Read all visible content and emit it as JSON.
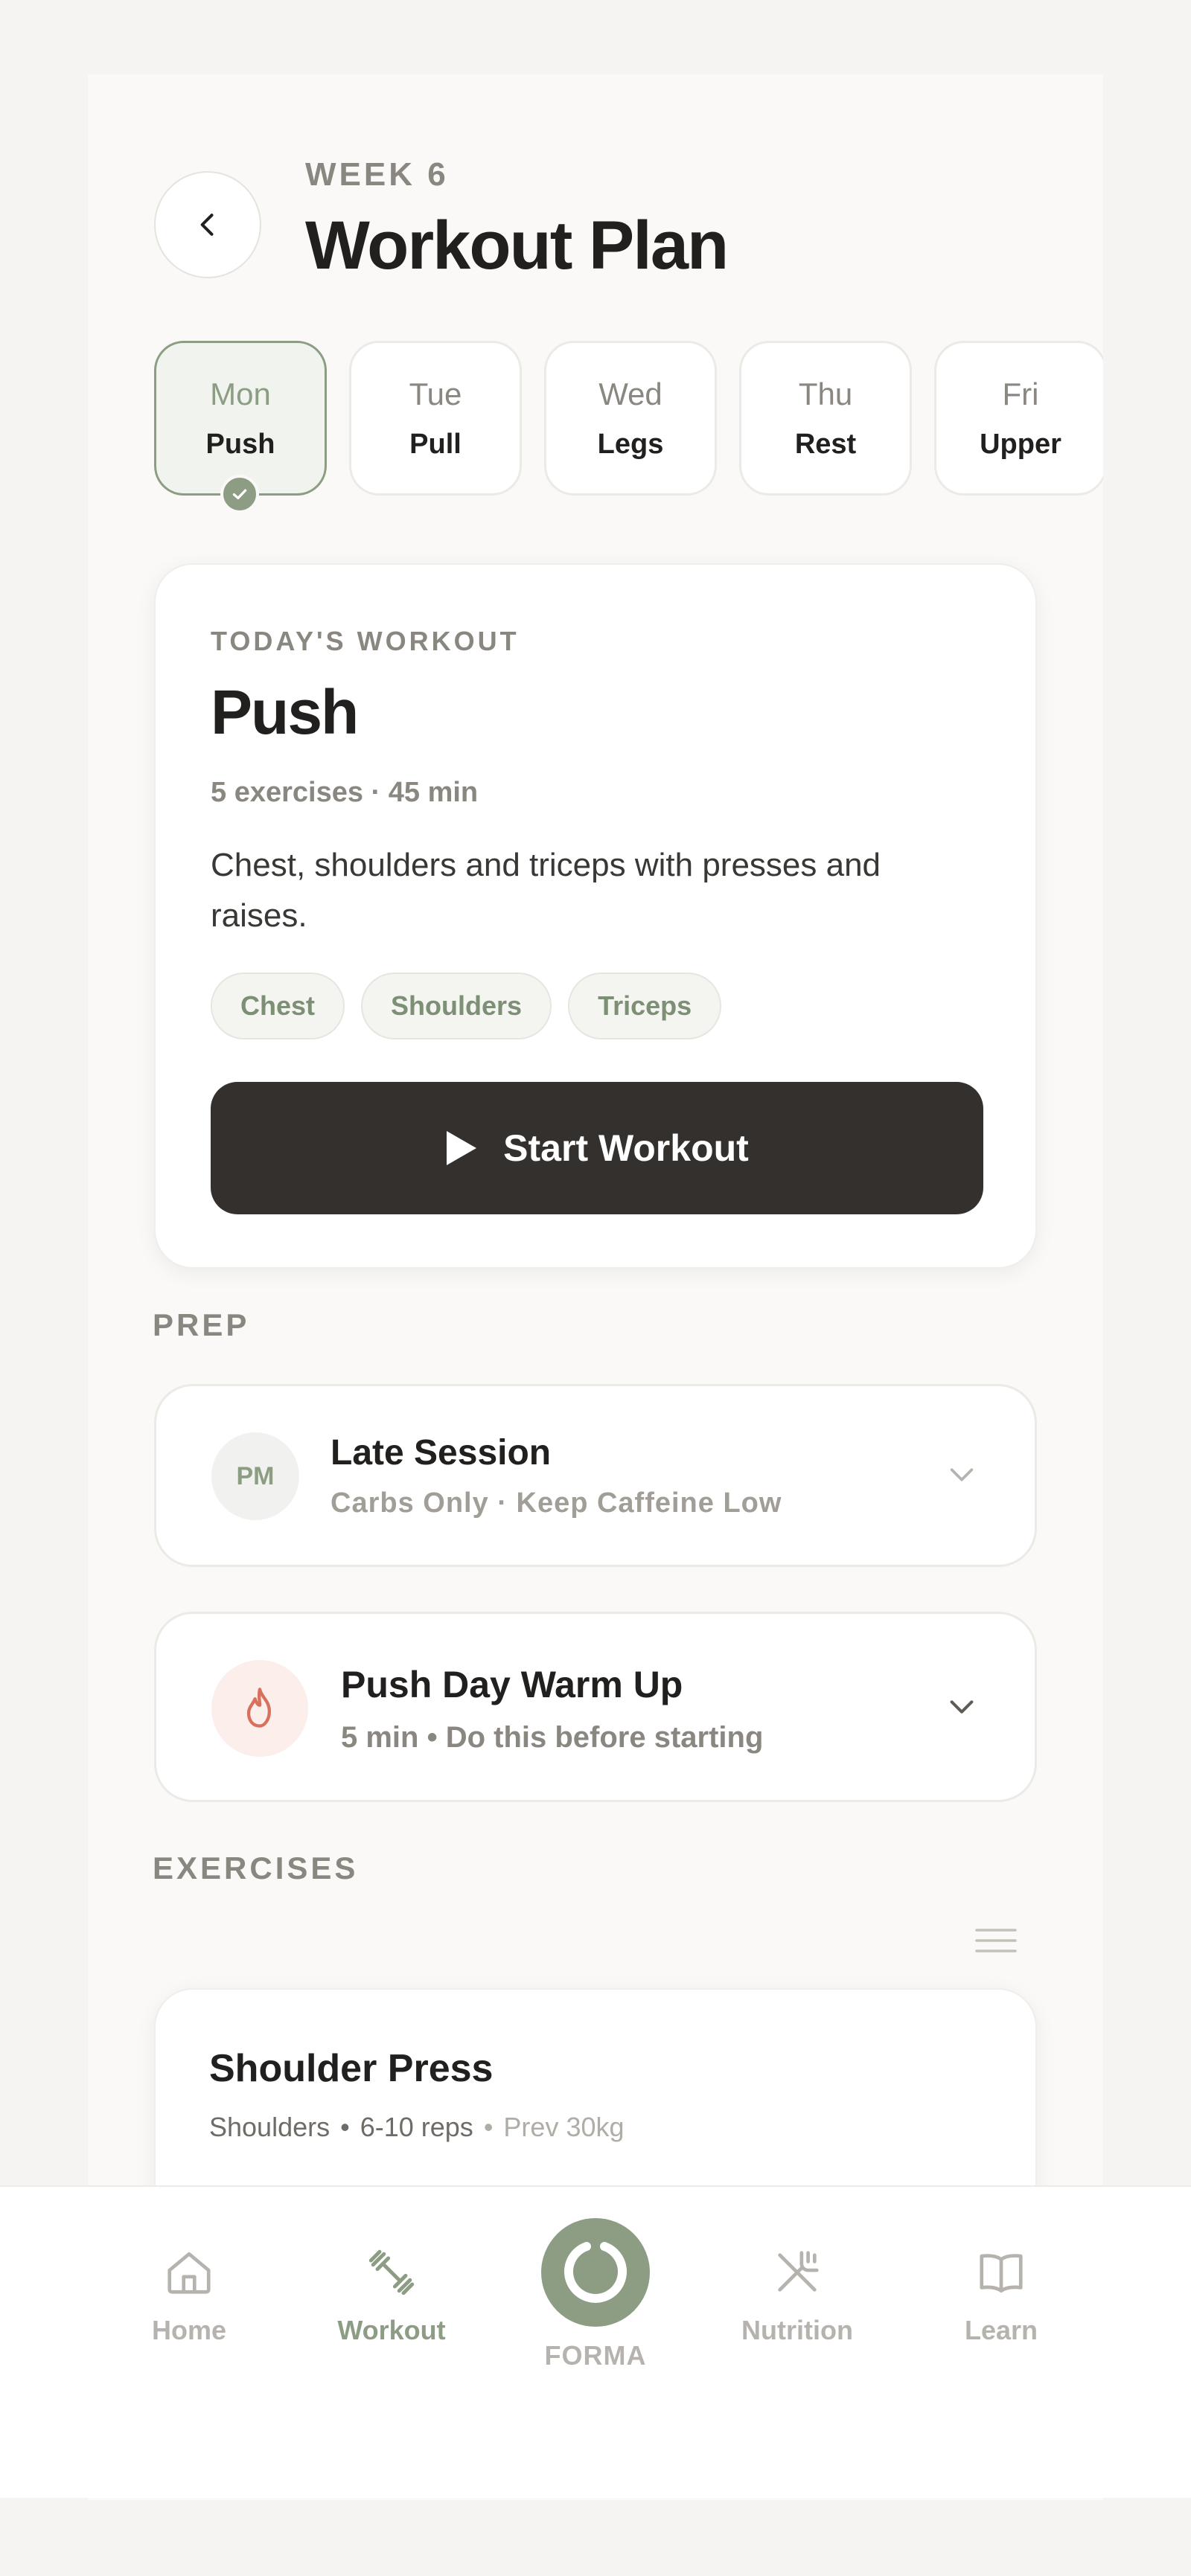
{
  "header": {
    "week": "WEEK 6",
    "title": "Workout Plan"
  },
  "days": [
    {
      "day": "Mon",
      "type": "Push",
      "active": true
    },
    {
      "day": "Tue",
      "type": "Pull",
      "active": false
    },
    {
      "day": "Wed",
      "type": "Legs",
      "active": false
    },
    {
      "day": "Thu",
      "type": "Rest",
      "active": false
    },
    {
      "day": "Fri",
      "type": "Upper",
      "active": false
    }
  ],
  "today": {
    "label": "TODAY'S WORKOUT",
    "title": "Push",
    "meta": "5 exercises · 45 min",
    "description": "Chest, shoulders and triceps with presses and raises.",
    "tags": [
      "Chest",
      "Shoulders",
      "Triceps"
    ],
    "start_label": "Start Workout"
  },
  "prep": {
    "label": "PREP",
    "session": {
      "badge": "PM",
      "title": "Late Session",
      "subtitle": "Carbs Only · Keep Caffeine Low"
    },
    "warmup": {
      "title": "Push Day Warm Up",
      "subtitle": "5 min • Do this before starting"
    }
  },
  "exercises": {
    "label": "EXERCISES",
    "items": [
      {
        "name": "Shoulder Press",
        "muscle": "Shoulders",
        "reps": "6-10 reps",
        "prev": "Prev 30kg"
      }
    ]
  },
  "nav": {
    "home": "Home",
    "workout": "Workout",
    "center": "FORMA",
    "nutrition": "Nutrition",
    "learn": "Learn"
  },
  "colors": {
    "accent": "#8d9d84",
    "dark_button": "#34302d",
    "warmup_badge": "#fbeeeb",
    "flame": "#d9705d"
  }
}
